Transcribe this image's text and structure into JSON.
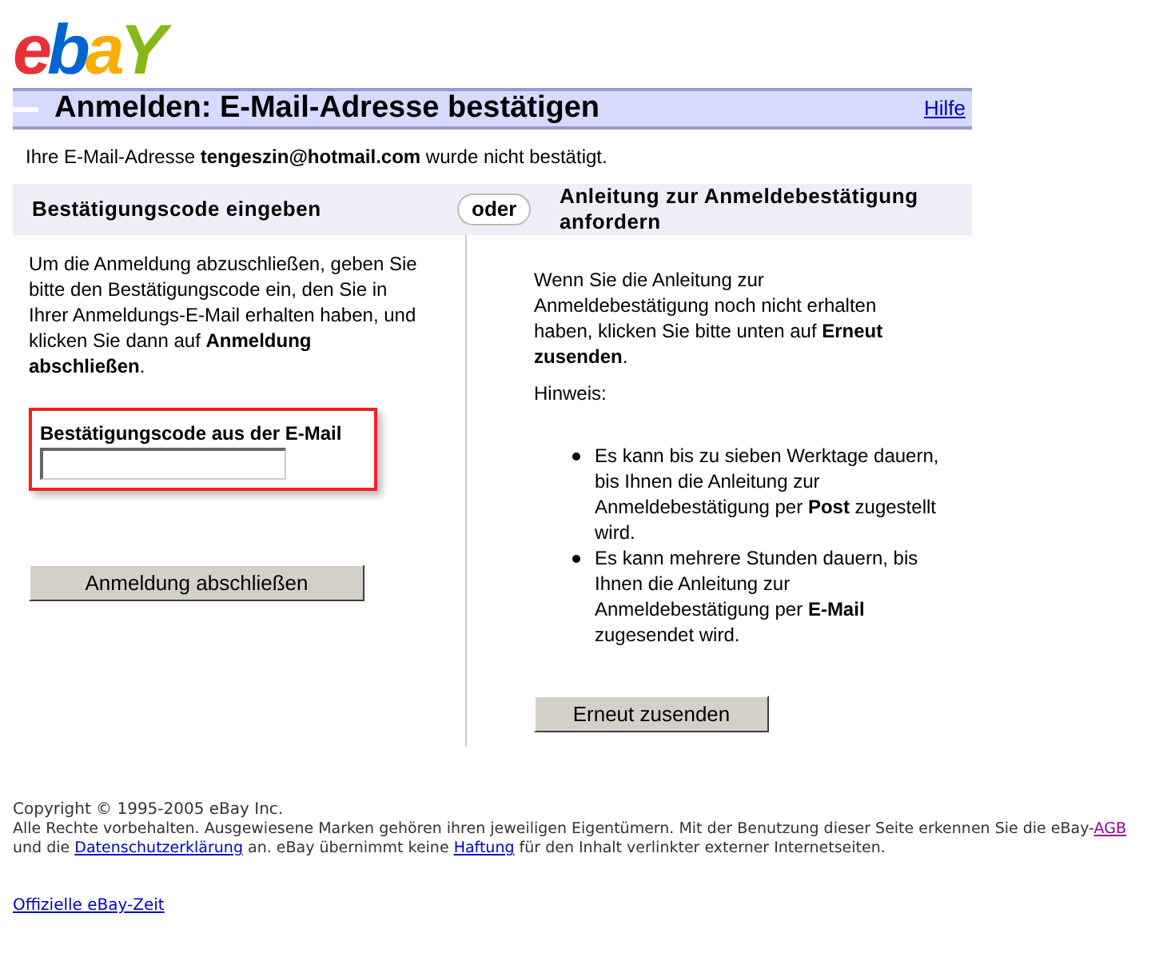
{
  "logo": "ebaY",
  "header": {
    "title": "Anmelden: E-Mail-Adresse bestätigen",
    "help_link": "Hilfe"
  },
  "notice": "Ihre E-Mail-Adresse **tengeszin@hotmail.com** wurde nicht bestätigt.",
  "left": {
    "heading": "Bestätigungscode eingeben",
    "text": "Um die Anmeldung abzuschließen, geben Sie bitte den Bestätigungscode ein, den Sie in Ihrer Anmeldungs-E-Mail erhalten haben, und klicken Sie dann auf **Anmeldung abschließen**.",
    "field_label": "Bestätigungscode aus der E-Mail",
    "highlighted": true,
    "button": "Anmeldung abschließen"
  },
  "separator": "oder",
  "right": {
    "heading": "Anleitung zur Anmeldebestätigung anfordern",
    "text": "Wenn Sie die Anleitung zur Anmeldebestätigung noch nicht erhalten haben, klicken Sie bitte unten auf **Erneut zusenden**.",
    "note_label": "Hinweis:",
    "bullets": [
      "Es kann bis zu sieben Werktage dauern, bis Ihnen die Anleitung zur Anmeldebestätigung per **Post** zugestellt wird.",
      "Es kann mehrere Stunden dauern, bis Ihnen die Anleitung zur Anmeldebestätigung per **E-Mail** zugesendet wird."
    ],
    "button": "Erneut zusenden"
  },
  "footer": {
    "copyright": "Copyright © 1995-2005 eBay Inc.",
    "legal": [
      {
        "kind": "text",
        "text": "Alle Rechte vorbehalten. Ausgewiesene Marken gehören ihren jeweiligen Eigentümern. Mit der Benutzung dieser Seite erkennen Sie die eBay-"
      },
      {
        "kind": "link",
        "text": "AGB",
        "visited": true
      },
      {
        "kind": "text",
        "text": " und die "
      },
      {
        "kind": "link",
        "text": "Datenschutzerklärung",
        "visited": false
      },
      {
        "kind": "text",
        "text": " an. eBay übernimmt keine "
      },
      {
        "kind": "link",
        "text": "Haftung",
        "visited": false
      },
      {
        "kind": "text",
        "text": " für den Inhalt verlinkter externer Internetseiten."
      }
    ],
    "time_link": "Offizielle eBay-Zeit"
  }
}
